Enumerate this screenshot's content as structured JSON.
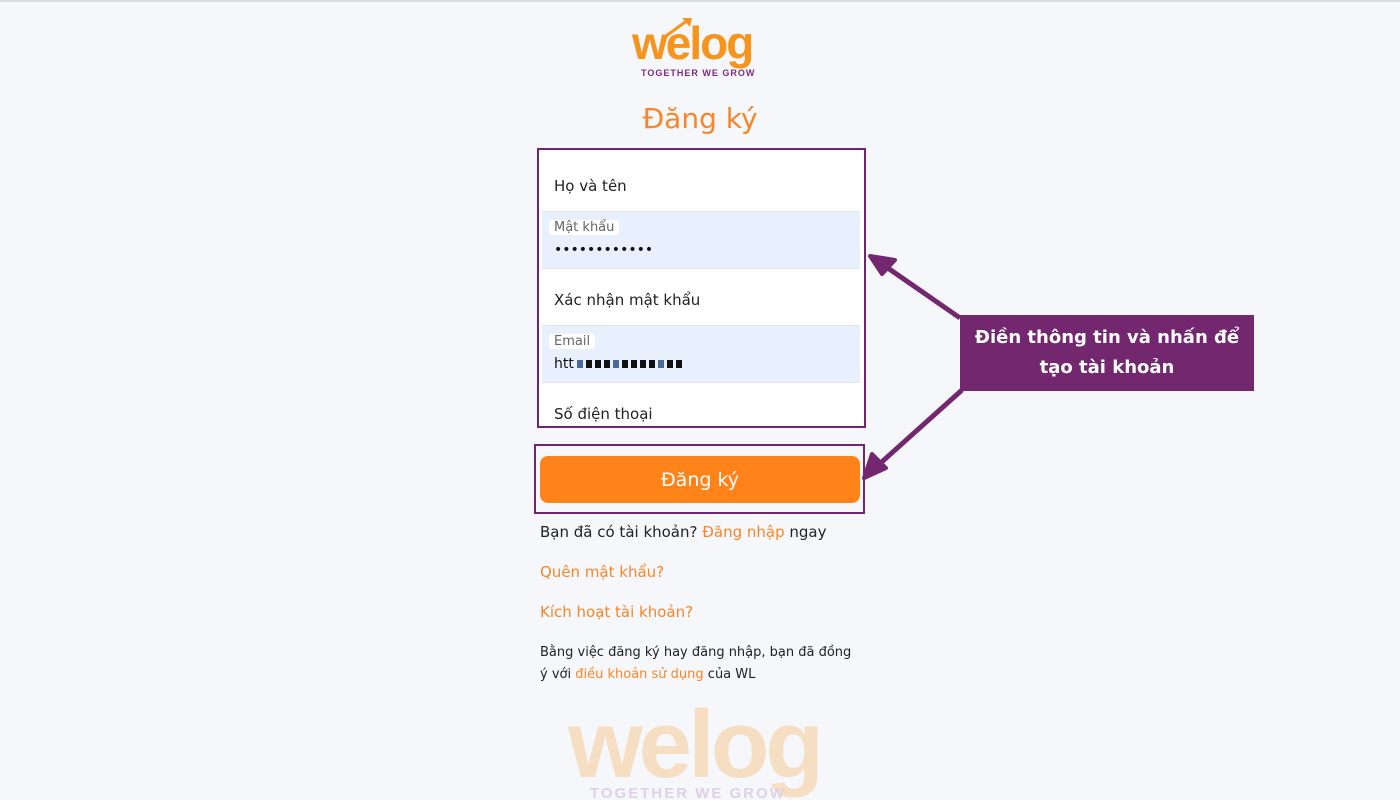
{
  "brand": {
    "logo_text": "welog",
    "tagline": "TOGETHER WE GROW"
  },
  "page": {
    "title": "Đăng ký"
  },
  "form": {
    "full_name_placeholder": "Họ và tên",
    "password_label": "Mật khẩu",
    "password_value": "••••••••••••",
    "confirm_password_placeholder": "Xác nhận mật khẩu",
    "email_label": "Email",
    "email_value_prefix": "htt",
    "phone_placeholder": "Số điện thoại",
    "submit_label": "Đăng ký"
  },
  "links": {
    "have_account_prefix": "Bạn đã có tài khoản?",
    "login_link": "Đăng nhập",
    "have_account_suffix": "ngay",
    "forgot_password": "Quên mật khẩu?",
    "activate_account": "Kích hoạt tài khoản?"
  },
  "terms": {
    "prefix": "Bằng việc đăng ký hay đăng nhập, bạn đã đồng ý với",
    "link": "điều khoản sử dụng",
    "suffix": "của WL"
  },
  "annotation": {
    "callout_line1": "Điền thông tin và nhấn để",
    "callout_line2": "tạo tài khoản",
    "color": "#73276f"
  },
  "colors": {
    "accent": "#ff8318",
    "brand_purple": "#6f2670"
  }
}
